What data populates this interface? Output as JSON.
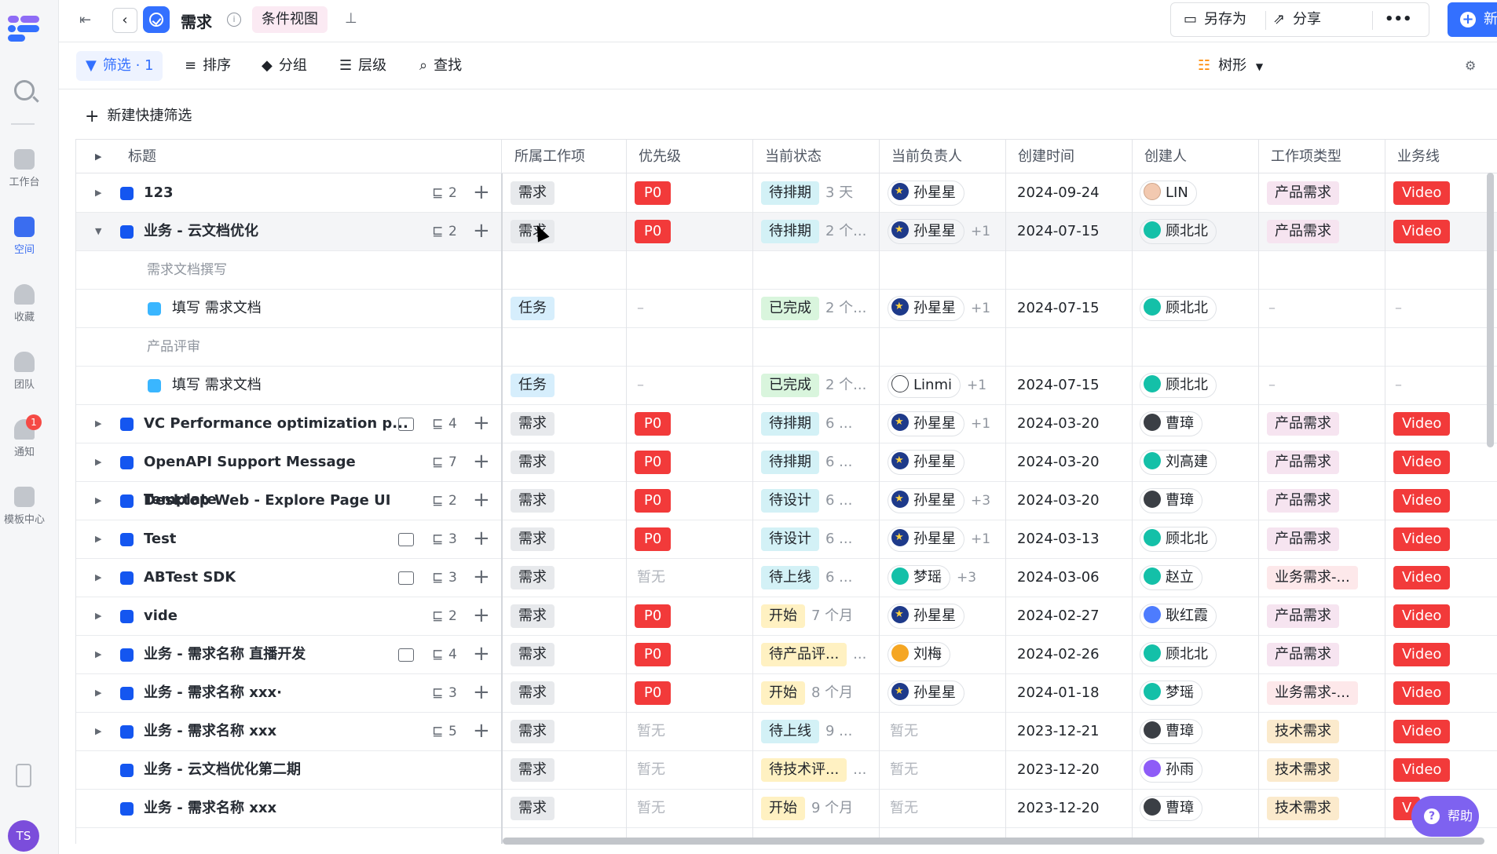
{
  "app": {
    "title": "需求",
    "view_tag": "条件视图",
    "user_initials": "TS"
  },
  "sidebar": {
    "items": [
      {
        "label": "工作台",
        "icon": "workbench-icon"
      },
      {
        "label": "空间",
        "icon": "space-icon"
      },
      {
        "label": "收藏",
        "icon": "star-icon"
      },
      {
        "label": "团队",
        "icon": "team-icon"
      },
      {
        "label": "通知",
        "icon": "bell-icon",
        "badge": "1"
      },
      {
        "label": "模板中心",
        "icon": "template-icon"
      }
    ]
  },
  "header": {
    "save_as": "另存为",
    "share": "分享",
    "more": "•••",
    "new": "新建"
  },
  "toolbar": {
    "filter": "筛选 · 1",
    "sort": "排序",
    "group": "分组",
    "level": "层级",
    "find": "查找",
    "view_mode": "树形"
  },
  "quick_filter": "新建快捷筛选",
  "table": {
    "columns": [
      "标题",
      "所属工作项",
      "优先级",
      "当前状态",
      "当前负责人",
      "创建时间",
      "创建人",
      "工作项类型",
      "业务线"
    ],
    "rows": [
      {
        "title": "123",
        "children": "2",
        "item": "需求",
        "priority": "P0",
        "status": "待排期",
        "status_dur": "3 天",
        "owner": "孙星星",
        "owner_more": "",
        "created": "2024-09-24",
        "creator": "LIN",
        "type": "产品需求",
        "line": "Video"
      },
      {
        "title": "业务 - 云文档优化",
        "children": "2",
        "item": "需求",
        "priority": "P0",
        "status": "待排期",
        "status_dur": "2 个...",
        "owner": "孙星星",
        "owner_more": "+1",
        "created": "2024-07-15",
        "creator": "顾北北",
        "type": "产品需求",
        "line": "Video"
      },
      {
        "group": "需求文档撰写"
      },
      {
        "title": "填写 需求文档",
        "item": "任务",
        "priority": "–",
        "status": "已完成",
        "status_dur": "2 个...",
        "owner": "孙星星",
        "owner_more": "+1",
        "created": "2024-07-15",
        "creator": "顾北北",
        "type": "–",
        "line": "–"
      },
      {
        "group": "产品评审"
      },
      {
        "title": "填写 需求文档",
        "item": "任务",
        "priority": "–",
        "status": "已完成",
        "status_dur": "2 个...",
        "owner": "Linmi",
        "owner_more": "+1",
        "created": "2024-07-15",
        "creator": "顾北北",
        "type": "–",
        "line": "–"
      },
      {
        "title": "VC Performance optimization p...",
        "children": "4",
        "item": "需求",
        "priority": "P0",
        "status": "待排期",
        "status_dur": "6 ...",
        "owner": "孙星星",
        "owner_more": "+1",
        "created": "2024-03-20",
        "creator": "曹璋",
        "type": "产品需求",
        "line": "Video"
      },
      {
        "title": "OpenAPI Support Message Template",
        "children": "7",
        "item": "需求",
        "priority": "P0",
        "status": "待排期",
        "status_dur": "6 ...",
        "owner": "孙星星",
        "owner_more": "",
        "created": "2024-03-20",
        "creator": "刘高建",
        "type": "产品需求",
        "line": "Video"
      },
      {
        "title": "Desktop Web - Explore Page UI",
        "children": "2",
        "item": "需求",
        "priority": "P0",
        "status": "待设计",
        "status_dur": "6 ...",
        "owner": "孙星星",
        "owner_more": "+3",
        "created": "2024-03-20",
        "creator": "曹璋",
        "type": "产品需求",
        "line": "Video"
      },
      {
        "title": "Test",
        "children": "3",
        "item": "需求",
        "priority": "P0",
        "status": "待设计",
        "status_dur": "6 ...",
        "owner": "孙星星",
        "owner_more": "+1",
        "created": "2024-03-13",
        "creator": "顾北北",
        "type": "产品需求",
        "line": "Video"
      },
      {
        "title": "ABTest SDK",
        "children": "3",
        "item": "需求",
        "priority": "暂无",
        "status": "待上线",
        "status_dur": "6 ...",
        "owner": "梦瑶",
        "owner_more": "+3",
        "created": "2024-03-06",
        "creator": "赵立",
        "type": "业务需求-...",
        "line": "Video"
      },
      {
        "title": "vide",
        "children": "2",
        "item": "需求",
        "priority": "P0",
        "status": "开始",
        "status_dur": "7 个月",
        "owner": "孙星星",
        "owner_more": "",
        "created": "2024-02-27",
        "creator": "耿红霞",
        "type": "产品需求",
        "line": "Video"
      },
      {
        "title": "业务 - 需求名称 直播开发",
        "children": "4",
        "item": "需求",
        "priority": "P0",
        "status": "待产品评...",
        "status_dur": "...",
        "owner": "刘梅",
        "owner_more": "",
        "created": "2024-02-26",
        "creator": "顾北北",
        "type": "产品需求",
        "line": "Video"
      },
      {
        "title": "业务 - 需求名称 xxx·",
        "children": "3",
        "item": "需求",
        "priority": "P0",
        "status": "开始",
        "status_dur": "8 个月",
        "owner": "孙星星",
        "owner_more": "",
        "created": "2024-01-18",
        "creator": "梦瑶",
        "type": "业务需求-...",
        "line": "Video"
      },
      {
        "title": "业务 - 需求名称 xxx",
        "children": "5",
        "item": "需求",
        "priority": "暂无",
        "status": "待上线",
        "status_dur": "9 ...",
        "owner": "暂无",
        "owner_more": "",
        "created": "2023-12-21",
        "creator": "曹璋",
        "type": "技术需求",
        "line": "Video"
      },
      {
        "title": "业务 - 云文档优化第二期",
        "item": "需求",
        "priority": "暂无",
        "status": "待技术评...",
        "status_dur": "...",
        "owner": "暂无",
        "owner_more": "",
        "created": "2023-12-20",
        "creator": "孙雨",
        "type": "技术需求",
        "line": "Video"
      },
      {
        "title": "业务 - 需求名称 xxx",
        "item": "需求",
        "priority": "暂无",
        "status": "开始",
        "status_dur": "9 个月",
        "owner": "暂无",
        "owner_more": "",
        "created": "2023-12-20",
        "creator": "曹璋",
        "type": "技术需求",
        "line": "V"
      }
    ]
  },
  "help": "帮助",
  "colors": {
    "accent": "#3370ff",
    "p0": "#f23a3a",
    "view_tag_bg": "#fbeaf3"
  }
}
